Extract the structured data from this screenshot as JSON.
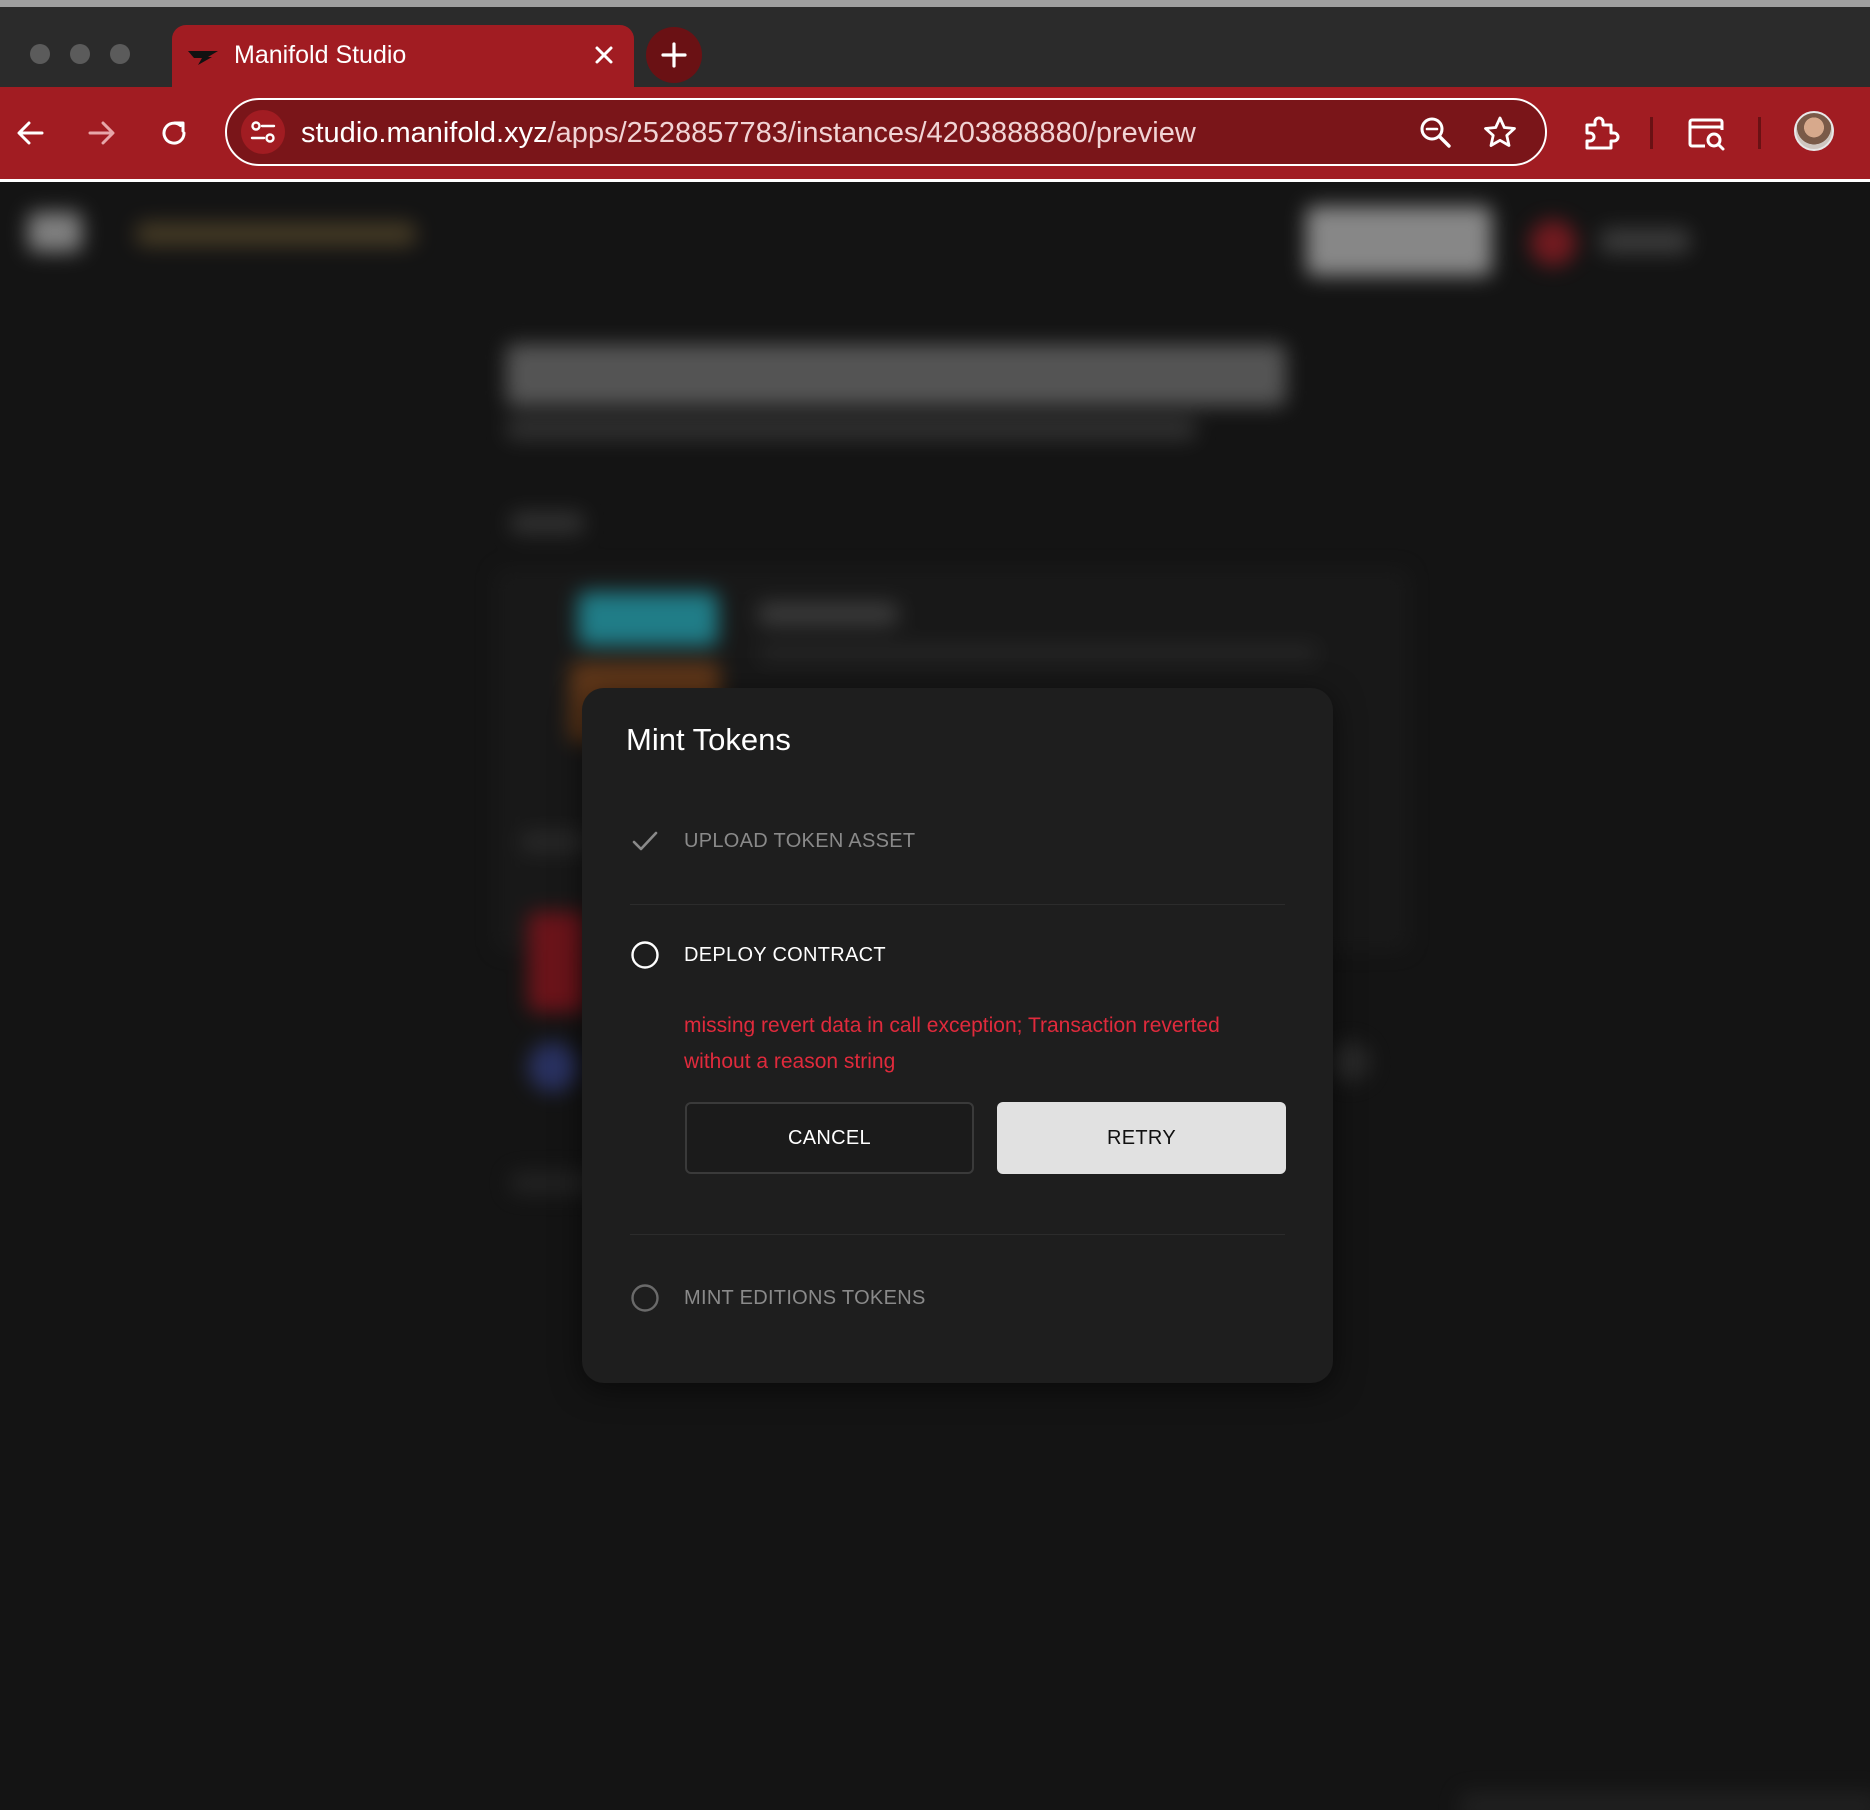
{
  "browser": {
    "tab": {
      "title": "Manifold Studio"
    },
    "url": {
      "host": "studio.manifold.xyz",
      "path": "/apps/2528857783/instances/4203888880/preview"
    }
  },
  "modal": {
    "title": "Mint Tokens",
    "steps": [
      {
        "label": "UPLOAD TOKEN ASSET",
        "state": "done",
        "icon": "checkmark-icon"
      },
      {
        "label": "DEPLOY CONTRACT",
        "state": "active",
        "icon": "circle-icon"
      },
      {
        "label": "MINT EDITIONS TOKENS",
        "state": "pending",
        "icon": "circle-icon"
      }
    ],
    "error": {
      "line1": "missing revert data in call exception; Transaction reverted",
      "line2": "without a reason string"
    },
    "buttons": {
      "cancel": "CANCEL",
      "retry": "RETRY"
    }
  },
  "colors": {
    "chrome_accent": "#a11c22",
    "error": "#e02a3c",
    "modal_bg": "#1e1e1e",
    "page_bg": "#141414"
  }
}
